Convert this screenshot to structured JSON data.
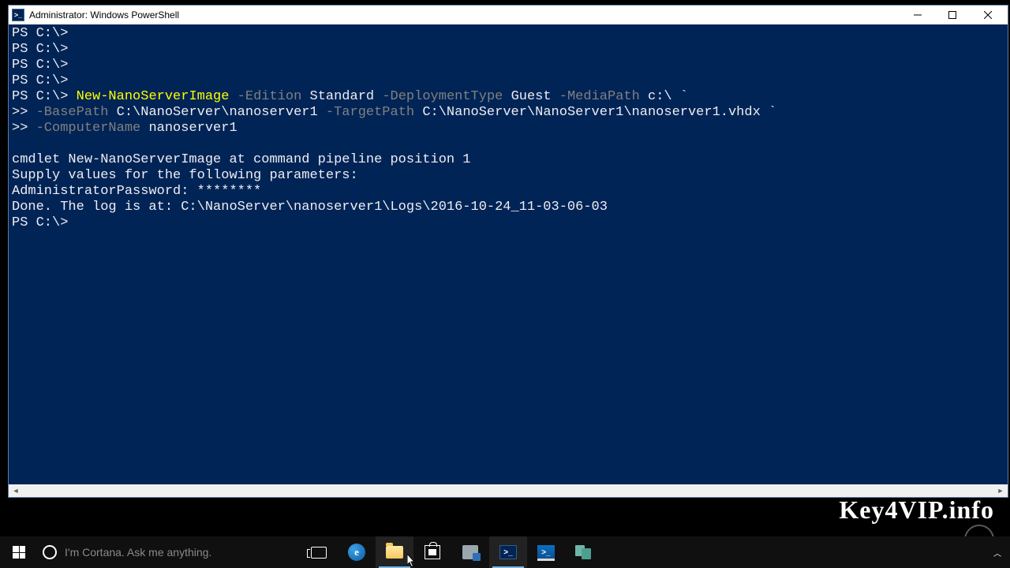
{
  "window": {
    "title": "Administrator: Windows PowerShell"
  },
  "prompt": "PS C:\\>",
  "cont_prompt": ">>",
  "cmd": {
    "cmdlet": "New-NanoServerImage",
    "p_edition": "-Edition",
    "v_edition": "Standard",
    "p_deploy": "-DeploymentType",
    "v_deploy": "Guest",
    "p_media": "-MediaPath",
    "v_media": "c:\\",
    "p_base": "-BasePath",
    "v_base": "C:\\NanoServer\\nanoserver1",
    "p_target": "-TargetPath",
    "v_target": "C:\\NanoServer\\NanoServer1\\nanoserver1.vhdx",
    "p_cname": "-ComputerName",
    "v_cname": "nanoserver1",
    "tick": "`"
  },
  "output": {
    "l1": "cmdlet New-NanoServerImage at command pipeline position 1",
    "l2": "Supply values for the following parameters:",
    "l3": "AdministratorPassword: ********",
    "l4": "Done. The log is at: C:\\NanoServer\\nanoserver1\\Logs\\2016-10-24_11-03-06-03"
  },
  "watermark": "Key4VIP.info",
  "taskbar": {
    "cortana_placeholder": "I'm Cortana. Ask me anything."
  }
}
